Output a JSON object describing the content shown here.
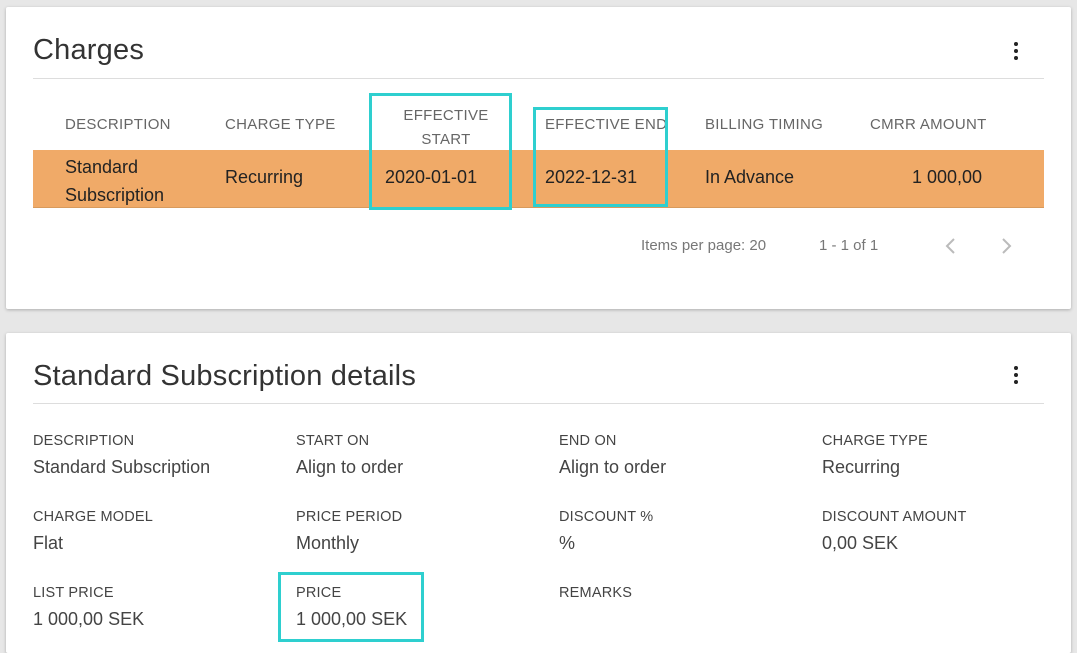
{
  "charges": {
    "title": "Charges",
    "menu_icon": "more-vertical-icon",
    "columns": [
      "DESCRIPTION",
      "CHARGE TYPE",
      "EFFECTIVE START",
      "EFFECTIVE END",
      "BILLING TIMING",
      "CMRR AMOUNT"
    ],
    "column_effective_start_line1": "EFFECTIVE",
    "column_effective_start_line2": "START",
    "rows": [
      {
        "description_line1": "Standard",
        "description_line2": "Subscription",
        "charge_type": "Recurring",
        "effective_start": "2020-01-01",
        "effective_end": "2022-12-31",
        "billing_timing": "In Advance",
        "cmrr_amount": "1 000,00"
      }
    ],
    "paginator": {
      "items_per_page": "Items per page: 20",
      "range": "1 - 1 of 1"
    },
    "row_highlight_color": "#f0aa68",
    "annotation_color": "#2ecfcf"
  },
  "details": {
    "title": "Standard Subscription details",
    "fields": {
      "description": {
        "label": "DESCRIPTION",
        "value": "Standard Subscription"
      },
      "start_on": {
        "label": "START ON",
        "value": "Align to order"
      },
      "end_on": {
        "label": "END ON",
        "value": "Align to order"
      },
      "charge_type": {
        "label": "CHARGE TYPE",
        "value": "Recurring"
      },
      "charge_model": {
        "label": "CHARGE MODEL",
        "value": "Flat"
      },
      "price_period": {
        "label": "PRICE PERIOD",
        "value": "Monthly"
      },
      "discount_pct": {
        "label": "DISCOUNT %",
        "value": "%"
      },
      "discount_amount": {
        "label": "DISCOUNT AMOUNT",
        "value": "0,00 SEK"
      },
      "list_price": {
        "label": "LIST PRICE",
        "value": "1 000,00 SEK"
      },
      "price": {
        "label": "PRICE",
        "value": "1 000,00 SEK"
      },
      "remarks": {
        "label": "REMARKS",
        "value": ""
      }
    }
  }
}
